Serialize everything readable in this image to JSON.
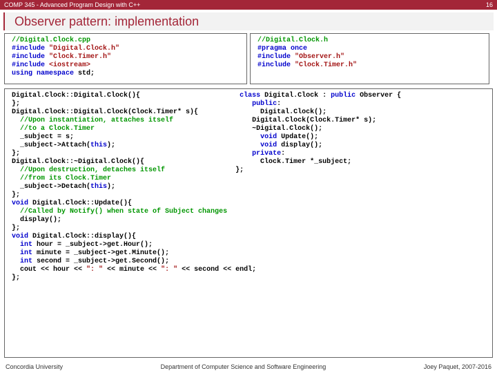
{
  "header": {
    "left": "COMP 345 - Advanced Program Design with C++",
    "right": "16"
  },
  "title": "Observer pattern: implementation",
  "code_cpp_top": "//Digital.Clock.cpp\n#include \"Digital.Clock.h\"\n#include \"Clock.Timer.h\"\n#include <iostream>\nusing namespace std;",
  "code_h": "//Digital.Clock.h\n#pragma once\n#include \"Observer.h\"\n#include \"Clock.Timer.h\"",
  "code_main": "Digital.Clock::Digital.Clock(){\n};\nDigital.Clock::Digital.Clock(Clock.Timer* s){\n  //Upon instantiation, attaches itself\n  //to a Clock.Timer\n  _subject = s;\n  _subject->Attach(this);\n};\nDigital.Clock::~Digital.Clock(){\n  //Upon destruction, detaches itself\n  //from its Clock.Timer\n  _subject->Detach(this);\n};\nvoid Digital.Clock::Update(){\n  //Called by Notify() when state of Subject changes\n  display();\n};\nvoid Digital.Clock::display(){\n  int hour = _subject->get.Hour();\n  int minute = _subject->get.Minute();\n  int second = _subject->get.Second();\n  cout << hour << \": \" << minute << \": \" << second << endl;\n};",
  "code_class": "class Digital.Clock : public Observer {\n    public:\n      Digital.Clock();\n      Digital.Clock(Clock.Timer* s);\n      ~Digital.Clock();\n      void Update();\n      void display();\n    private:\n      Clock.Timer *_subject;\n};",
  "footer": {
    "left": "Concordia University",
    "center": "Department of Computer Science and Software Engineering",
    "right": "Joey Paquet, 2007-2016"
  }
}
